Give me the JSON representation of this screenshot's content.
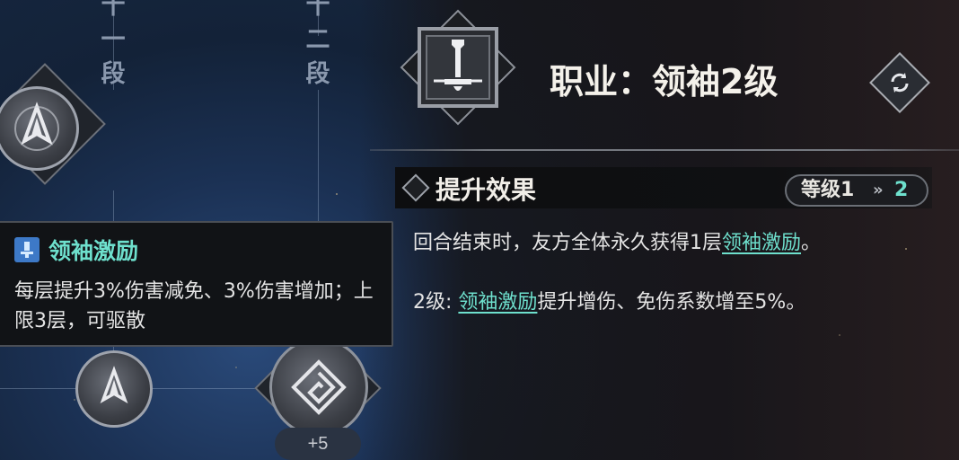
{
  "tree": {
    "tier_11": [
      "十",
      "一",
      "段"
    ],
    "tier_12": [
      "十",
      "二",
      "段"
    ],
    "plus_badge": "+5"
  },
  "tooltip": {
    "title": "领袖激励",
    "description": "每层提升3%伤害减免、3%伤害增加；上限3层，可驱散",
    "icon": "leader-inspire-icon",
    "title_color": "#6ee0cd"
  },
  "class_panel": {
    "title": "职业：领袖2级",
    "section_title": "提升效果",
    "level_from": "等级1",
    "level_arrow": "»",
    "level_to": "2",
    "effect_line1_prefix": "回合结束时，友方全体永久获得1层",
    "effect_line1_keyword": "领袖激励",
    "effect_line1_suffix": "。",
    "effect_line2_prefix": "2级: ",
    "effect_line2_keyword": "领袖激励",
    "effect_line2_suffix": "提升增伤、免伤系数增至5%。",
    "accent_color": "#6ee0cd"
  }
}
